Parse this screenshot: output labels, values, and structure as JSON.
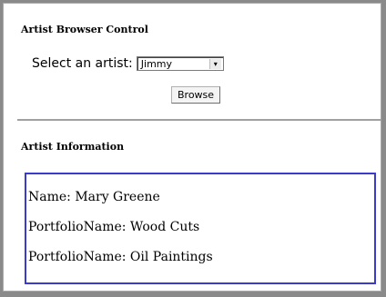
{
  "control": {
    "heading": "Artist Browser Control",
    "select_label": "Select an artist:",
    "selected_artist": "Jimmy",
    "browse_label": "Browse"
  },
  "info": {
    "heading": "Artist Information",
    "lines": [
      "Name: Mary Greene",
      "PortfolioName: Wood Cuts",
      "PortfolioName: Oil Paintings"
    ]
  },
  "colors": {
    "info_border": "#3a3acc",
    "background": "#8a8a8a"
  },
  "icons": {
    "dropdown": "chevron-down-icon"
  }
}
